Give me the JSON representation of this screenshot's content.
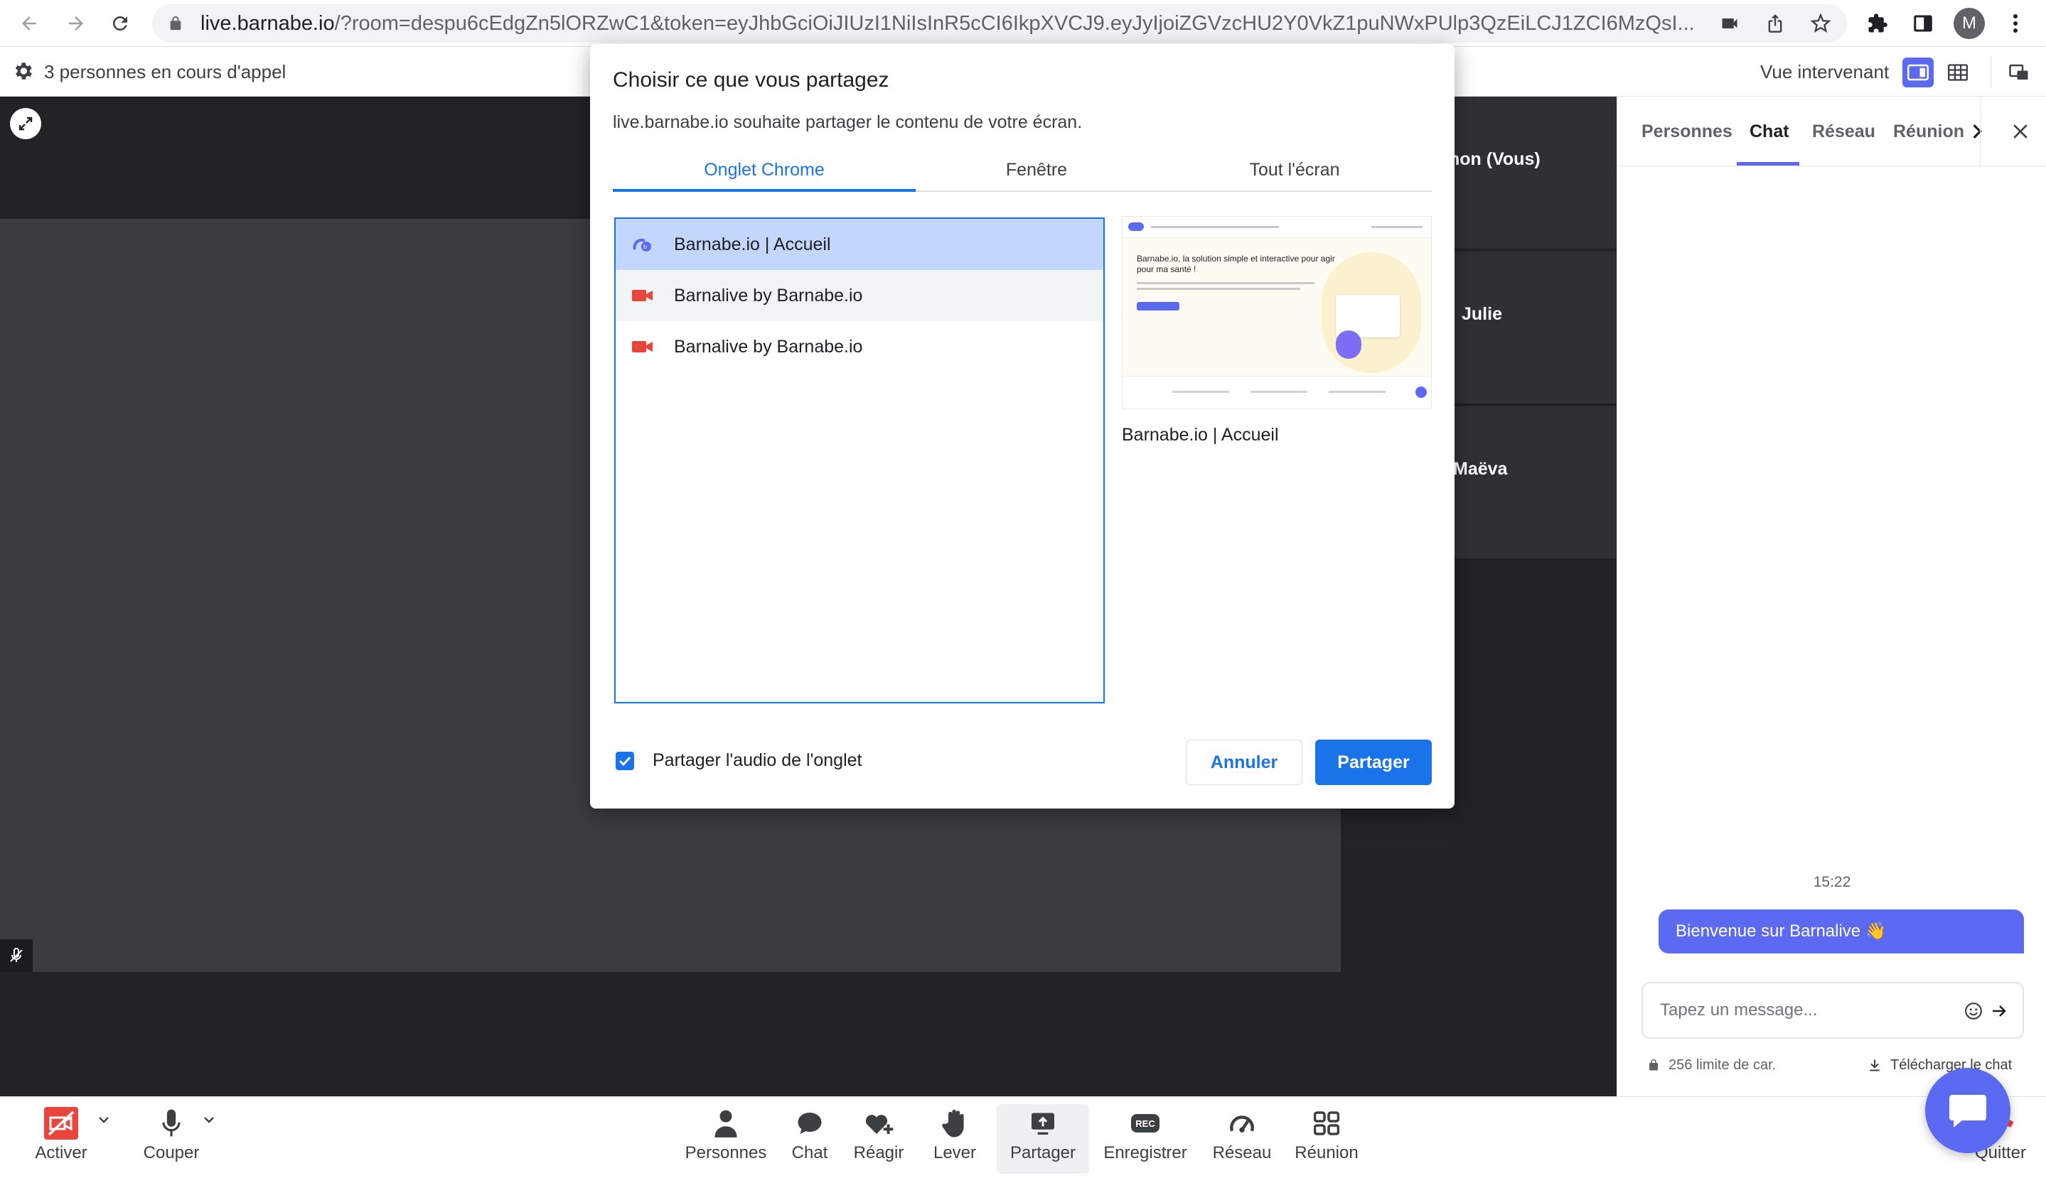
{
  "browser": {
    "url_host": "live.barnabe.io",
    "url_rest": "/?room=despu6cEdgZn5lORZwC1&token=eyJhbGciOiJIUzI1NiIsInR5cCI6IkpXVCJ9.eyJyIjoiZGVzcHU2Y0VkZ1puNWxPUlp3QzEiLCJ1ZCI6MzQsI...",
    "profile_initial": "M"
  },
  "appbar": {
    "call_status": "3 personnes en cours d'appel",
    "view_label": "Vue intervenant"
  },
  "tiles": [
    {
      "name": "non (Vous)"
    },
    {
      "name": "Julie"
    },
    {
      "name": "Maëva"
    }
  ],
  "panel": {
    "tabs": [
      {
        "label": "Personnes"
      },
      {
        "label": "Chat"
      },
      {
        "label": "Réseau"
      },
      {
        "label": "Réunion"
      }
    ],
    "chat_time": "15:22",
    "chat_message": "Bienvenue sur Barnalive 👋",
    "input_placeholder": "Tapez un message...",
    "char_limit": "256 limite de car.",
    "download_label": "Télécharger le chat"
  },
  "toolbar": {
    "activer": "Activer",
    "couper": "Couper",
    "personnes": "Personnes",
    "chat": "Chat",
    "reagir": "Réagir",
    "lever": "Lever",
    "partager": "Partager",
    "enregistrer": "Enregistrer",
    "reseau": "Réseau",
    "reunion": "Réunion",
    "quitter": "Quitter",
    "rec_badge": "REC"
  },
  "dialog": {
    "title": "Choisir ce que vous partagez",
    "subtitle": "live.barnabe.io souhaite partager le contenu de votre écran.",
    "tabs": [
      {
        "label": "Onglet Chrome"
      },
      {
        "label": "Fenêtre"
      },
      {
        "label": "Tout l'écran"
      }
    ],
    "items": [
      {
        "title": "Barnabe.io | Accueil"
      },
      {
        "title": "Barnalive by Barnabe.io"
      },
      {
        "title": "Barnalive by Barnabe.io"
      }
    ],
    "preview_caption": "Barnabe.io | Accueil",
    "preview_headline": "Barnabe.io, la solution simple et interactive pour agir pour ma santé !",
    "audio_label": "Partager l'audio de l'onglet",
    "cancel_label": "Annuler",
    "share_label": "Partager"
  },
  "colors": {
    "accent": "#5b6af0",
    "chrome_blue": "#1a73e8",
    "stage_dark": "#222327"
  }
}
